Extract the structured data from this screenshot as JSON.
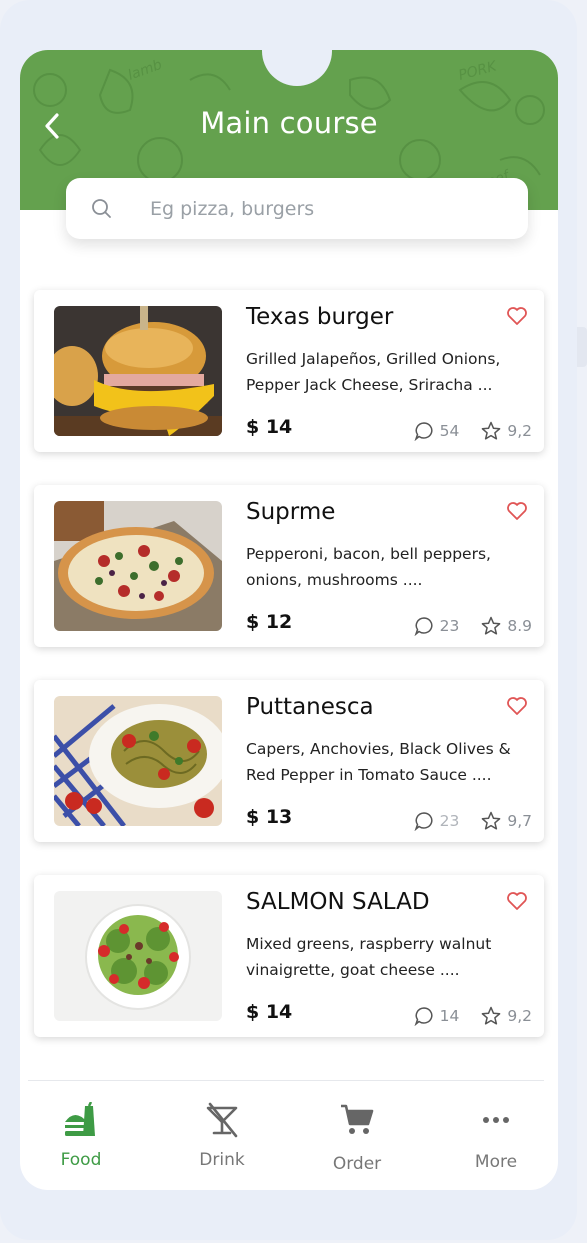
{
  "header": {
    "title": "Main course",
    "back_icon": "chevron-left-icon",
    "color": "#64a14e"
  },
  "search": {
    "placeholder": "Eg pizza, burgers",
    "icon": "search-icon"
  },
  "items": [
    {
      "name": "Texas burger",
      "description": "Grilled Jalapeños, Grilled Onions, Pepper Jack Cheese, Sriracha ...",
      "price": "$ 14",
      "comments": "54",
      "rating": "9,2",
      "image": "burger"
    },
    {
      "name": "Suprme",
      "description": "Pepperoni, bacon, bell peppers, onions, mushrooms ....",
      "price": "$ 12",
      "comments": "23",
      "rating": "8.9",
      "image": "pizza"
    },
    {
      "name": "Puttanesca",
      "description": "Capers, Anchovies, Black Olives & Red Pepper in Tomato Sauce ....",
      "price": "$ 13",
      "comments": "23",
      "rating": "9,7",
      "image": "pasta"
    },
    {
      "name": "SALMON SALAD",
      "description": "Mixed greens, raspberry walnut vinaigrette, goat cheese ....",
      "price": "$ 14",
      "comments": "14",
      "rating": "9,2",
      "image": "salad"
    }
  ],
  "nav": {
    "items": [
      {
        "label": "Food",
        "icon": "food-icon",
        "active": true
      },
      {
        "label": "Drink",
        "icon": "drink-icon",
        "active": false
      },
      {
        "label": "Order",
        "icon": "cart-icon",
        "active": false
      },
      {
        "label": "More",
        "icon": "more-icon",
        "active": false
      }
    ],
    "active_color": "#3e9b45"
  },
  "colors": {
    "accent": "#64a14e",
    "heart": "#e05555",
    "meta": "#8a8f96"
  }
}
